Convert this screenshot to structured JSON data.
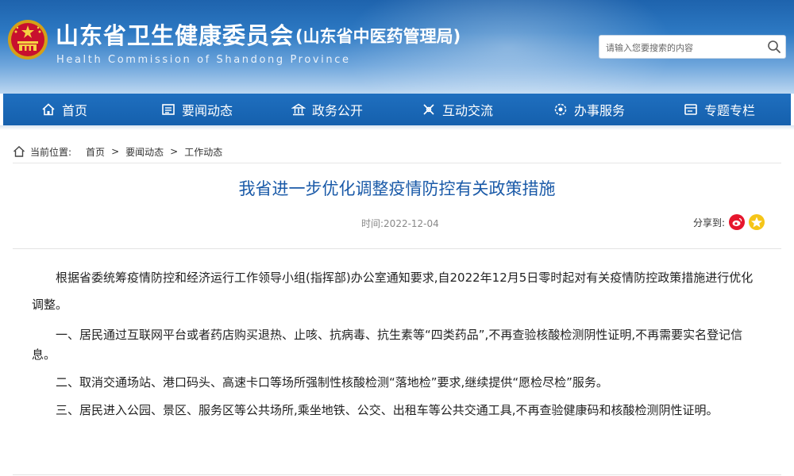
{
  "header": {
    "title": "山东省卫生健康委员会",
    "subtitle": "(山东省中医药管理局)",
    "english": "Health Commission of Shandong Province",
    "search_placeholder": "请输入您要搜索的内容",
    "emblem_icon": "national-emblem-icon",
    "search_icon": "search-icon"
  },
  "nav": {
    "items": [
      {
        "label": "首页",
        "icon": "home-icon"
      },
      {
        "label": "要闻动态",
        "icon": "news-icon"
      },
      {
        "label": "政务公开",
        "icon": "building-icon"
      },
      {
        "label": "互动交流",
        "icon": "exchange-icon"
      },
      {
        "label": "办事服务",
        "icon": "service-icon"
      },
      {
        "label": "专题专栏",
        "icon": "column-icon"
      }
    ]
  },
  "breadcrumb": {
    "label": "当前位置:",
    "items": [
      "首页",
      "要闻动态",
      "工作动态"
    ],
    "separator": ">"
  },
  "article": {
    "title": "我省进一步优化调整疫情防控有关政策措施",
    "date_label": "时间:",
    "date": "2022-12-04",
    "share_label": "分享到:",
    "share_icons": [
      "weibo-icon",
      "qzone-icon"
    ],
    "paragraphs": [
      "根据省委统筹疫情防控和经济运行工作领导小组(指挥部)办公室通知要求,自2022年12月5日零时起对有关疫情防控政策措施进行优化调整。",
      "一、居民通过互联网平台或者药店购买退热、止咳、抗病毒、抗生素等“四类药品”,不再查验核酸检测阴性证明,不再需要实名登记信息。",
      "二、取消交通场站、港口码头、高速卡口等场所强制性核酸检测“落地检”要求,继续提供“愿检尽检”服务。",
      "三、居民进入公园、景区、服务区等公共场所,乘坐地铁、公交、出租车等公共交通工具,不再查验健康码和核酸检测阴性证明。"
    ]
  },
  "colors": {
    "header_blue": "#1e63ad",
    "nav_blue": "#1560ad",
    "title_blue": "#1a5aa8",
    "weibo_red": "#e6162d",
    "qzone_yellow": "#f5c518"
  }
}
